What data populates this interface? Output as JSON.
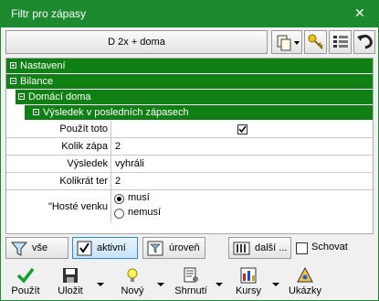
{
  "window": {
    "title": "Filtr pro zápasy",
    "close_glyph": "✕"
  },
  "topbar": {
    "filter_button": "D 2x + doma",
    "tools": [
      "copy-icon",
      "key-icon",
      "list-icon",
      "undo-icon"
    ]
  },
  "tree": {
    "groups": [
      {
        "label": "Nastavení",
        "expanded": false
      },
      {
        "label": "Bilance",
        "expanded": true
      },
      {
        "label": "Domácí doma",
        "expanded": true
      },
      {
        "label": "Výsledek v posledních zápasech",
        "expanded": true
      }
    ],
    "rows": [
      {
        "name": "Použít toto",
        "value": "",
        "checked": true
      },
      {
        "name": "Kolik zápa",
        "value": "2"
      },
      {
        "name": "Výsledek",
        "value": "vyhráli"
      },
      {
        "name": "Kolikrát ter",
        "value": "2"
      },
      {
        "name": "\"Hosté venku",
        "options": [
          "musí",
          "nemusí"
        ],
        "selected": "musí"
      }
    ]
  },
  "buttons": {
    "all": "vše",
    "active": "aktivní",
    "level": "úroveň",
    "more": "další ...",
    "hide": "Schovat"
  },
  "bottom": {
    "use": "Použít",
    "save": "Uložit",
    "new": "Nový",
    "summary": "Shrnutí",
    "odds": "Kursy",
    "samples": "Ukázky"
  }
}
